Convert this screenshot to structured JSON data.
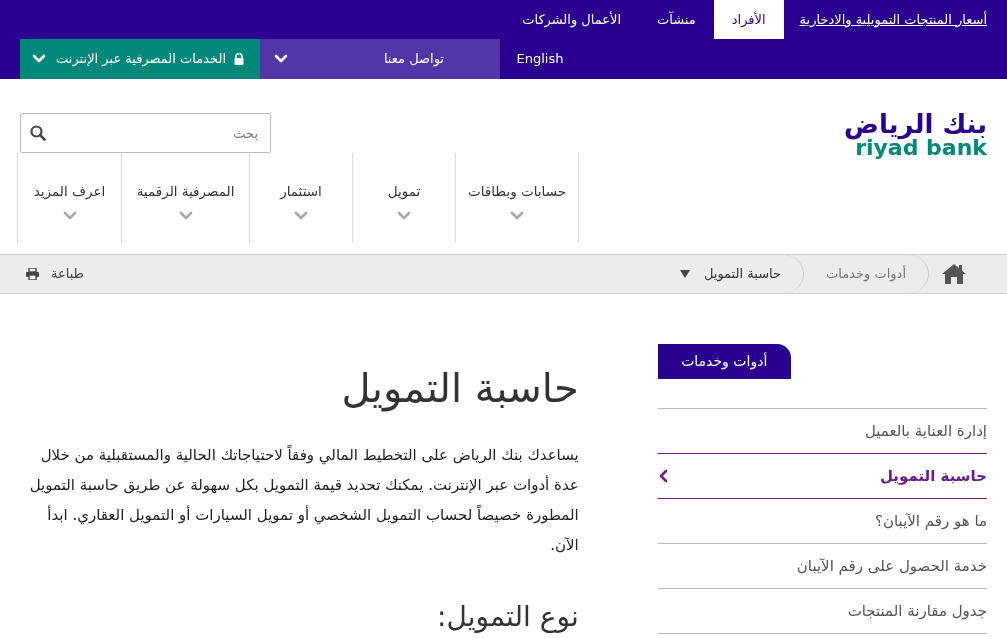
{
  "top_bar": {
    "rates_link": "أسعار المنتجات التمويلية والادخارية",
    "tabs": [
      {
        "label": "الأفراد",
        "selected": true
      },
      {
        "label": "منشآت",
        "selected": false
      },
      {
        "label": "الأعمال والشركات",
        "selected": false
      }
    ]
  },
  "utility_bar": {
    "language": "English",
    "contact": "تواصل معنا",
    "online_banking": "الخدمات المصرفية عبر الإنترنت"
  },
  "logo": {
    "arabic": "بنك الرياض",
    "latin": "riyad bank"
  },
  "search": {
    "placeholder": "بحث"
  },
  "nav": [
    {
      "label": "حسابات وبطاقات"
    },
    {
      "label": "تمويل"
    },
    {
      "label": "استثمار"
    },
    {
      "label": "المصرفية الرقمية"
    },
    {
      "label": "اعرف المزيد"
    }
  ],
  "breadcrumb": {
    "items": [
      {
        "label": "أدوات وخدمات",
        "current": false
      },
      {
        "label": "حاسبة التمويل",
        "current": true
      }
    ],
    "print": "طباعة"
  },
  "sidebar": {
    "title": "أدوات وخدمات",
    "items": [
      {
        "label": "إدارة العناية بالعميل",
        "selected": false
      },
      {
        "label": "حاسبة التمويل",
        "selected": true
      },
      {
        "label": "ما هو رقم الآيبان؟",
        "selected": false
      },
      {
        "label": "خدمة الحصول على رقم الآيبان",
        "selected": false
      },
      {
        "label": "جدول مقارنة المنتجات",
        "selected": false
      }
    ]
  },
  "content": {
    "title": "حاسبة التمويل",
    "intro": "يساعدك بنك الرياض على التخطيط المالي وفقاً لاحتياجاتك الحالية والمستقبلية من خلال عدة أدوات عبر الإنترنت. يمكنك تحديد قيمة التمويل بكل سهولة عن طريق حاسبة التمويل المطورة خصيصاً لحساب التمويل الشخصي أو تمويل السيارات أو التمويل العقاري. ابدأ الآن.",
    "section_title": "نوع التمويل:"
  }
}
